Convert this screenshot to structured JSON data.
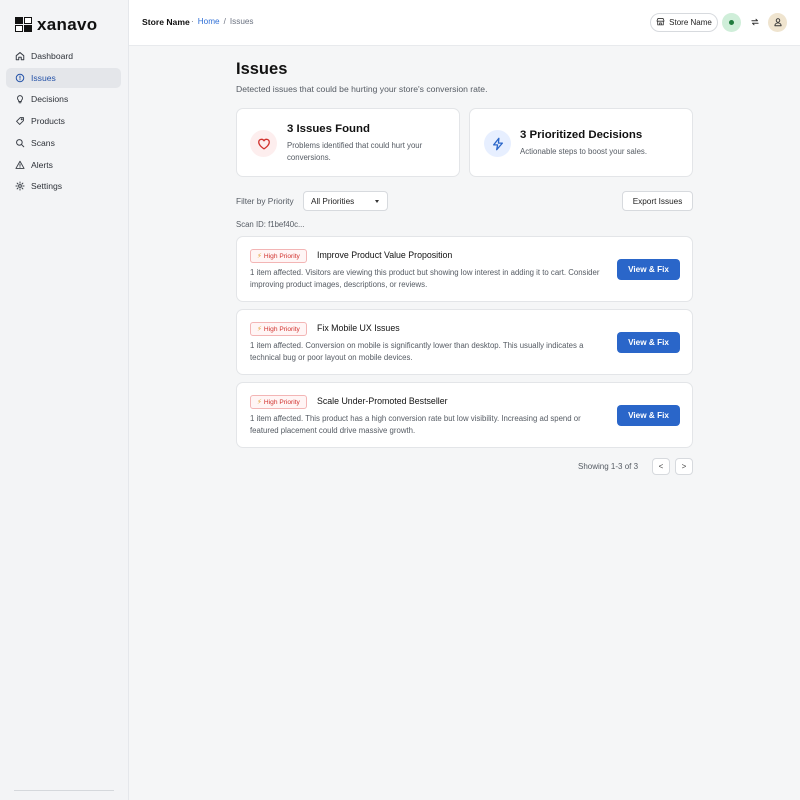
{
  "brand": {
    "logo_text": "xanavo"
  },
  "sidebar": {
    "items": [
      {
        "label": "Dashboard",
        "icon": "home-icon"
      },
      {
        "label": "Issues",
        "icon": "alert-circle-icon",
        "active": true
      },
      {
        "label": "Decisions",
        "icon": "lightbulb-icon"
      },
      {
        "label": "Products",
        "icon": "tag-icon"
      },
      {
        "label": "Scans",
        "icon": "search-icon"
      },
      {
        "label": "Alerts",
        "icon": "warning-triangle-icon"
      },
      {
        "label": "Settings",
        "icon": "gear-icon"
      }
    ]
  },
  "header": {
    "store_title": "Store Name",
    "breadcrumb_sep": "·",
    "breadcrumb_home": "Home",
    "breadcrumb_slash": "/",
    "breadcrumb_current": "Issues",
    "store_button_label": "Store Name",
    "status_color": "#1f7a3d"
  },
  "main": {
    "title": "Issues",
    "subtitle": "Detected issues that could be hurting your store's conversion rate.",
    "stats": [
      {
        "title": "3 Issues Found",
        "desc": "Problems identified that could hurt your conversions.",
        "icon": "heart-icon",
        "color": "#d0312d"
      },
      {
        "title": "3 Prioritized Decisions",
        "desc": "Actionable steps to boost your sales.",
        "icon": "lightning-icon",
        "color": "#2a66c9"
      }
    ],
    "filter_label": "Filter by Priority",
    "filter_value": "All Priorities",
    "export_label": "Export Issues",
    "scan_id": "Scan ID: f1bef40c...",
    "issues": [
      {
        "badge": "High Priority",
        "title": "Improve Product Value Proposition",
        "desc": "1 item affected. Visitors are viewing this product but showing low interest in adding it to cart. Consider improving product images, descriptions, or reviews.",
        "action": "View & Fix"
      },
      {
        "badge": "High Priority",
        "title": "Fix Mobile UX Issues",
        "desc": "1 item affected. Conversion on mobile is significantly lower than desktop. This usually indicates a technical bug or poor layout on mobile devices.",
        "action": "View & Fix"
      },
      {
        "badge": "High Priority",
        "title": "Scale Under-Promoted Bestseller",
        "desc": "1 item affected. This product has a high conversion rate but low visibility. Increasing ad spend or featured placement could drive massive growth.",
        "action": "View & Fix"
      }
    ],
    "pagination": {
      "text": "Showing 1-3 of 3",
      "prev": "<",
      "next": ">"
    }
  }
}
